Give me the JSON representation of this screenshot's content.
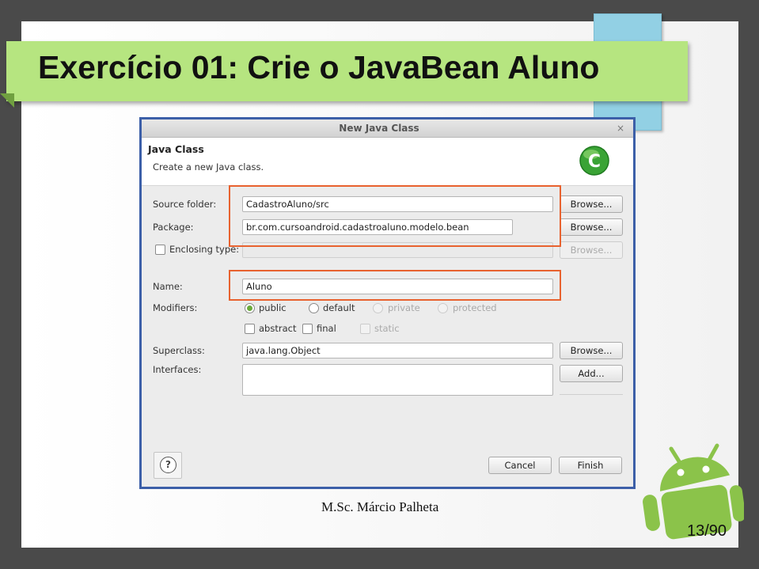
{
  "slide": {
    "title": "Exercício 01: Crie o JavaBean Aluno",
    "footer": "M.Sc. Márcio Palheta",
    "page_number": "13/90"
  },
  "dialog": {
    "window_title": "New Java Class",
    "close_glyph": "×",
    "header_title": "Java Class",
    "header_subtitle": "Create a new Java class.",
    "fields": {
      "source_folder": {
        "label": "Source folder:",
        "value": "CadastroAluno/src"
      },
      "package": {
        "label": "Package:",
        "value": "br.com.cursoandroid.cadastroaluno.modelo.bean"
      },
      "enclosing_type": {
        "label": "Enclosing type:",
        "value": "",
        "checked": false
      },
      "name": {
        "label": "Name:",
        "value": "Aluno"
      },
      "superclass": {
        "label": "Superclass:",
        "value": "java.lang.Object"
      },
      "interfaces": {
        "label": "Interfaces:"
      }
    },
    "modifiers": {
      "label": "Modifiers:",
      "access": [
        {
          "label": "public",
          "selected": true,
          "enabled": true
        },
        {
          "label": "default",
          "selected": false,
          "enabled": true
        },
        {
          "label": "private",
          "selected": false,
          "enabled": false
        },
        {
          "label": "protected",
          "selected": false,
          "enabled": false
        }
      ],
      "other": [
        {
          "label": "abstract",
          "checked": false,
          "enabled": true
        },
        {
          "label": "final",
          "checked": false,
          "enabled": true
        },
        {
          "label": "static",
          "checked": false,
          "enabled": false
        }
      ]
    },
    "buttons": {
      "browse": "Browse...",
      "add": "Add...",
      "cancel": "Cancel",
      "finish": "Finish",
      "help": "?"
    }
  },
  "colors": {
    "title_bar": "#b6e580",
    "highlight": "#e8622f",
    "frame": "#3c5fa8",
    "accent_tab": "#92d0e4",
    "android_green": "#8bc34a"
  },
  "icons": [
    "java-class-c-icon",
    "help-icon",
    "android-logo"
  ]
}
